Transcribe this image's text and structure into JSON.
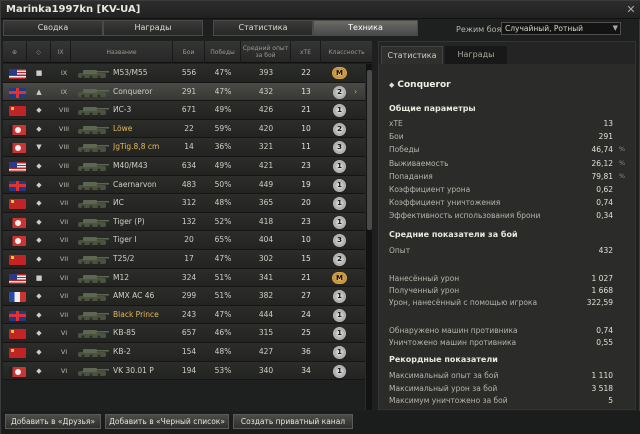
{
  "window": {
    "title": "Marinka1997kn [KV-UA]"
  },
  "tabs": [
    {
      "label": "Сводка",
      "active": false
    },
    {
      "label": "Награды",
      "active": false
    },
    {
      "label": "Статистика",
      "active": false
    },
    {
      "label": "Техника",
      "active": true
    }
  ],
  "battle_mode": {
    "label": "Режим боя:",
    "value": "Случайный, Ротный"
  },
  "table": {
    "headers": {
      "tier": "IX",
      "name": "Название",
      "battles": "Бои",
      "wins": "Победы",
      "exp": "Средний опыт за бой",
      "xte": "xTE",
      "class": "Классность"
    },
    "rows": [
      {
        "flag": "usa",
        "type_icon": "square",
        "tier": "IX",
        "name": "M53/M55",
        "battles": "556",
        "wins": "47%",
        "exp": "393",
        "xte": "22",
        "badge": "M",
        "gold": false
      },
      {
        "flag": "uk",
        "type_icon": "arrow-up",
        "tier": "IX",
        "name": "Conqueror",
        "battles": "291",
        "wins": "47%",
        "exp": "432",
        "xte": "13",
        "badge": "2",
        "gold": false,
        "selected": true
      },
      {
        "flag": "ussr",
        "type_icon": "diamond",
        "tier": "VIII",
        "name": "ИС-3",
        "battles": "671",
        "wins": "49%",
        "exp": "426",
        "xte": "21",
        "badge": "1",
        "gold": false
      },
      {
        "flag": "de",
        "type_icon": "diamond",
        "tier": "VIII",
        "name": "Löwe",
        "battles": "22",
        "wins": "59%",
        "exp": "420",
        "xte": "10",
        "badge": "2",
        "gold": true
      },
      {
        "flag": "de",
        "type_icon": "triangle-down",
        "tier": "VIII",
        "name": "JgTig.8,8 cm",
        "battles": "14",
        "wins": "36%",
        "exp": "321",
        "xte": "11",
        "badge": "3",
        "gold": true
      },
      {
        "flag": "usa",
        "type_icon": "diamond",
        "tier": "VIII",
        "name": "M40/M43",
        "battles": "634",
        "wins": "49%",
        "exp": "421",
        "xte": "23",
        "badge": "1",
        "gold": false
      },
      {
        "flag": "uk",
        "type_icon": "diamond",
        "tier": "VIII",
        "name": "Caernarvon",
        "battles": "483",
        "wins": "50%",
        "exp": "449",
        "xte": "19",
        "badge": "1",
        "gold": false
      },
      {
        "flag": "ussr",
        "type_icon": "diamond",
        "tier": "VII",
        "name": "ИС",
        "battles": "312",
        "wins": "48%",
        "exp": "365",
        "xte": "20",
        "badge": "1",
        "gold": false
      },
      {
        "flag": "de",
        "type_icon": "diamond",
        "tier": "VII",
        "name": "Tiger (P)",
        "battles": "132",
        "wins": "52%",
        "exp": "418",
        "xte": "23",
        "badge": "1",
        "gold": false
      },
      {
        "flag": "de",
        "type_icon": "diamond",
        "tier": "VII",
        "name": "Tiger I",
        "battles": "20",
        "wins": "65%",
        "exp": "404",
        "xte": "10",
        "badge": "3",
        "gold": false
      },
      {
        "flag": "ussr",
        "type_icon": "diamond",
        "tier": "VII",
        "name": "T25/2",
        "battles": "17",
        "wins": "47%",
        "exp": "302",
        "xte": "15",
        "badge": "2",
        "gold": false
      },
      {
        "flag": "usa",
        "type_icon": "square",
        "tier": "VII",
        "name": "M12",
        "battles": "324",
        "wins": "51%",
        "exp": "341",
        "xte": "21",
        "badge": "M",
        "gold": false
      },
      {
        "flag": "fr",
        "type_icon": "diamond",
        "tier": "VII",
        "name": "AMX AC 46",
        "battles": "299",
        "wins": "51%",
        "exp": "382",
        "xte": "27",
        "badge": "1",
        "gold": false
      },
      {
        "flag": "uk",
        "type_icon": "diamond",
        "tier": "VII",
        "name": "Black Prince",
        "battles": "243",
        "wins": "47%",
        "exp": "444",
        "xte": "24",
        "badge": "1",
        "gold": true
      },
      {
        "flag": "ussr",
        "type_icon": "diamond",
        "tier": "VI",
        "name": "КВ-85",
        "battles": "657",
        "wins": "46%",
        "exp": "315",
        "xte": "25",
        "badge": "1",
        "gold": false
      },
      {
        "flag": "ussr",
        "type_icon": "diamond",
        "tier": "VI",
        "name": "КВ-2",
        "battles": "154",
        "wins": "48%",
        "exp": "427",
        "xte": "36",
        "badge": "1",
        "gold": false
      },
      {
        "flag": "de",
        "type_icon": "diamond",
        "tier": "VI",
        "name": "VK 30.01 P",
        "battles": "194",
        "wins": "53%",
        "exp": "340",
        "xte": "34",
        "badge": "1",
        "gold": false
      }
    ]
  },
  "panel": {
    "tabs": [
      {
        "label": "Статистика",
        "active": true
      },
      {
        "label": "Награды",
        "active": false
      }
    ],
    "tank_name": "Conqueror",
    "general_title": "Общие параметры",
    "general": [
      {
        "k": "xTE",
        "v": "13",
        "u": ""
      },
      {
        "k": "Бои",
        "v": "291",
        "u": ""
      },
      {
        "k": "Победы",
        "v": "46,74",
        "u": "%"
      },
      {
        "k": "Выживаемость",
        "v": "26,12",
        "u": "%"
      },
      {
        "k": "Попадания",
        "v": "79,81",
        "u": "%"
      },
      {
        "k": "Коэффициент урона",
        "v": "0,62",
        "u": ""
      },
      {
        "k": "Коэффициент уничтожения",
        "v": "0,74",
        "u": ""
      },
      {
        "k": "Эффективность использования брони",
        "v": "0,34",
        "u": ""
      }
    ],
    "avg_title": "Средние показатели за бой",
    "avg": [
      {
        "k": "Опыт",
        "v": "432",
        "u": ""
      },
      {
        "k": "Нанесённый урон",
        "v": "1 027",
        "u": ""
      },
      {
        "k": "Полученный урон",
        "v": "1 668",
        "u": ""
      },
      {
        "k": "Урон, нанесённый с помощью игрока",
        "v": "322,59",
        "u": ""
      },
      {
        "k": "Обнаружено машин противника",
        "v": "0,74",
        "u": ""
      },
      {
        "k": "Уничтожено машин противника",
        "v": "0,55",
        "u": ""
      }
    ],
    "record_title": "Рекордные показатели",
    "records": [
      {
        "k": "Максимальный опыт за бой",
        "v": "1 110",
        "u": ""
      },
      {
        "k": "Максимальный урон за бой",
        "v": "3 518",
        "u": ""
      },
      {
        "k": "Максимум уничтожено за бой",
        "v": "5",
        "u": ""
      }
    ]
  },
  "footer": {
    "add_friends": "Добавить в «Друзья»",
    "add_blacklist": "Добавить в «Черный список»",
    "create_channel": "Создать приватный канал"
  }
}
